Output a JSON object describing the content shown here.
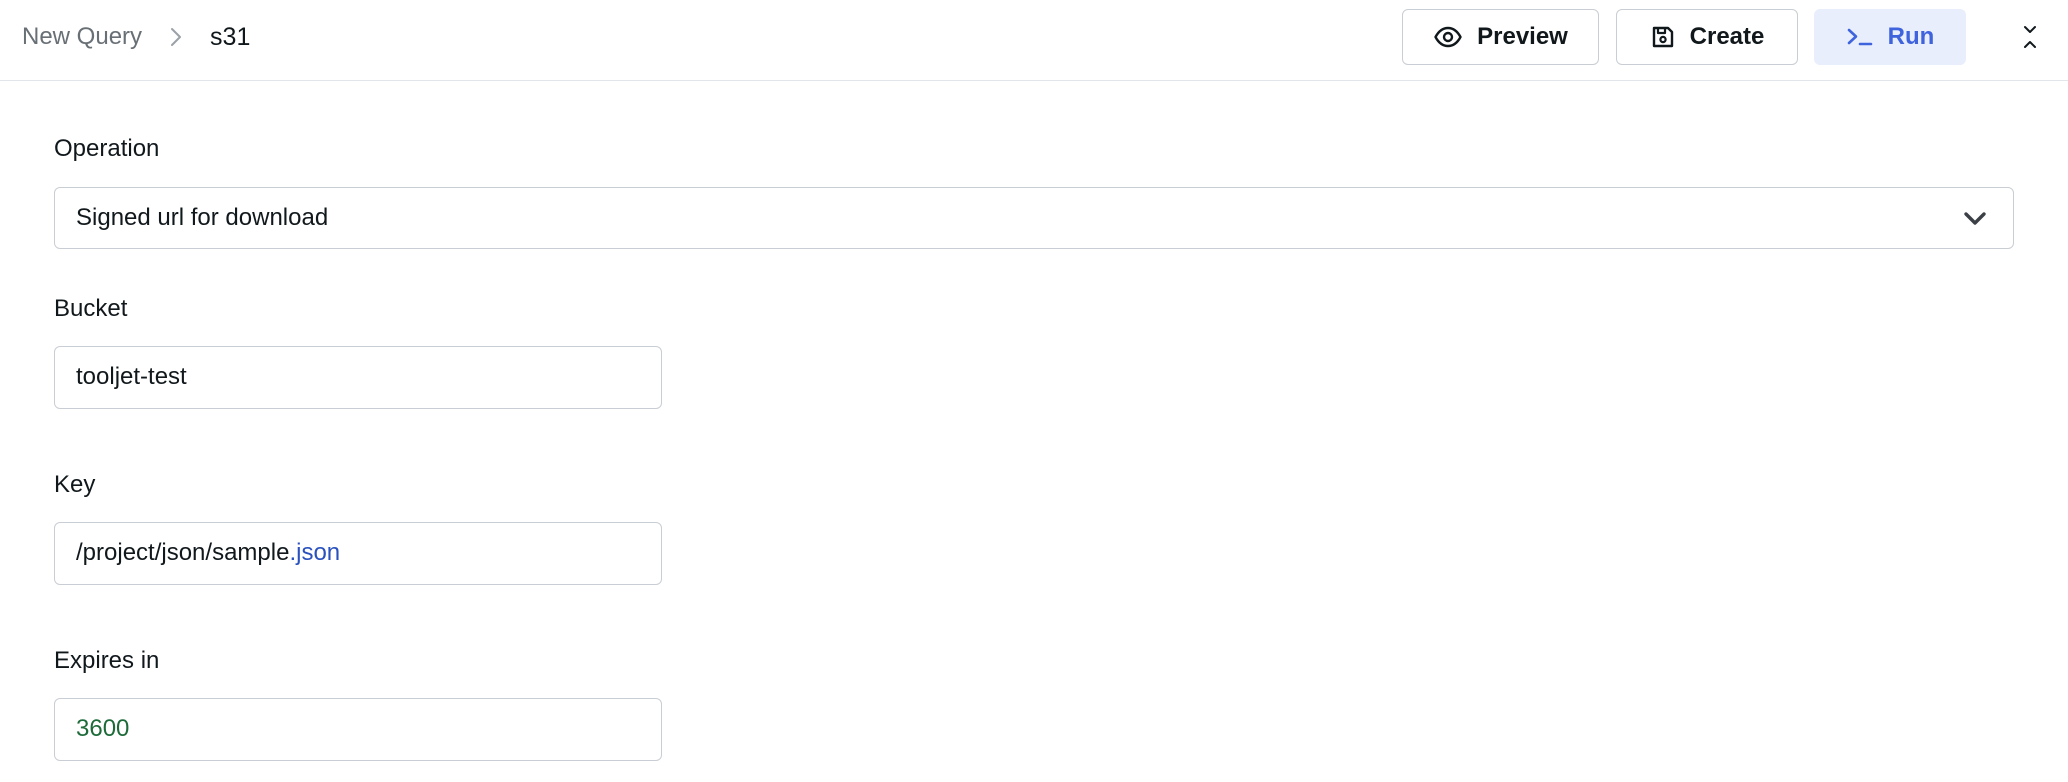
{
  "header": {
    "breadcrumb_parent": "New Query",
    "breadcrumb_current": "s31",
    "preview_label": "Preview",
    "create_label": "Create",
    "run_label": "Run"
  },
  "colors": {
    "accent": "#3e63dd",
    "run_bg": "#e9eefc",
    "string_token": "#2a52be",
    "number_token": "#1e6b3a"
  },
  "icons": {
    "preview": "eye-icon",
    "create": "save-icon",
    "run": "terminal-icon",
    "collapse": "collapse-icon",
    "breadcrumb_sep": "chevron-right-icon",
    "select": "chevron-down-icon"
  },
  "form": {
    "operation": {
      "label": "Operation",
      "value": "Signed url for download"
    },
    "bucket": {
      "label": "Bucket",
      "value": "tooljet-test"
    },
    "key": {
      "label": "Key",
      "value_path": "/project/json/sample",
      "value_ext": ".json"
    },
    "expires_in": {
      "label": "Expires in",
      "value": "3600"
    }
  }
}
